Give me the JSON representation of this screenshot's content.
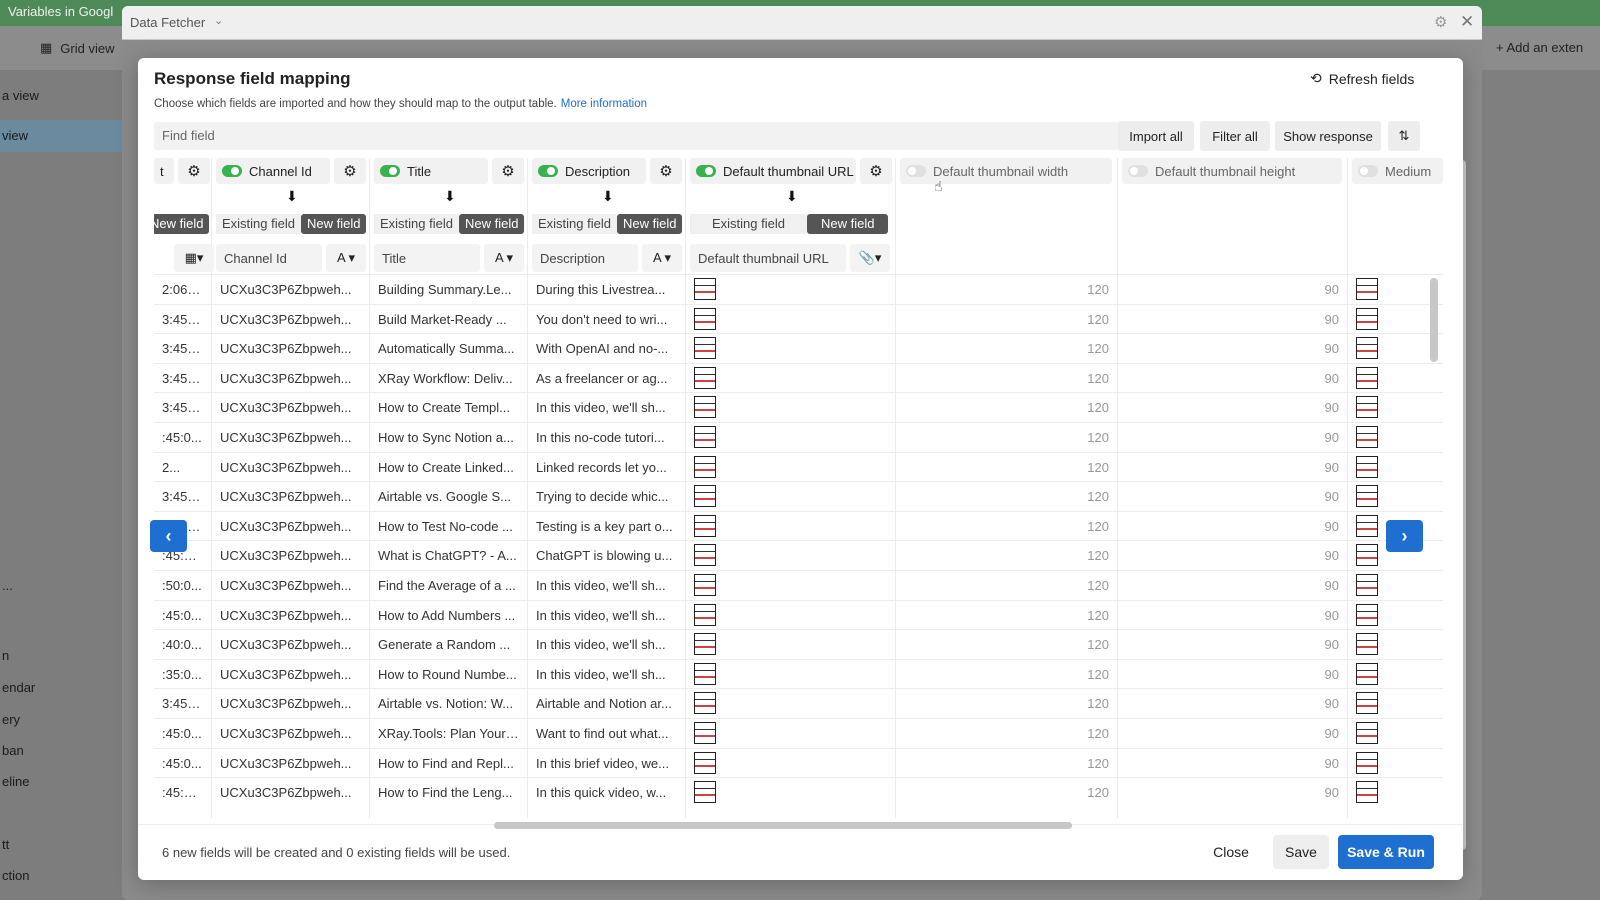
{
  "background": {
    "tab_title": "Variables in Googl",
    "grid_view": "Grid view",
    "add_extension": "Add an exten",
    "sidebar": [
      "a view",
      "view",
      "...",
      "n",
      "endar",
      "ery",
      "ban",
      "eline",
      "tt",
      "ction"
    ]
  },
  "frame": {
    "title": "Data Fetcher"
  },
  "modal": {
    "title": "Response field mapping",
    "refresh": "Refresh fields",
    "subtitle": "Choose which fields are imported and how they should map to the output table.",
    "more_info": "More information",
    "find_placeholder": "Find field",
    "buttons": {
      "import_all": "Import all",
      "filter_all": "Filter all",
      "show_response": "Show response"
    },
    "labels": {
      "existing": "Existing field",
      "new": "New field",
      "new_clipped": "New field"
    }
  },
  "columns": [
    {
      "key": "published",
      "name": "t",
      "field": ""
    },
    {
      "key": "channel",
      "name": "Channel Id",
      "field": "Channel Id",
      "type": "A"
    },
    {
      "key": "title",
      "name": "Title",
      "field": "Title",
      "type": "A"
    },
    {
      "key": "desc",
      "name": "Description",
      "field": "Description",
      "type": "A"
    },
    {
      "key": "thumb",
      "name": "Default thumbnail URL",
      "field": "Default thumbnail URL",
      "type": "📎"
    },
    {
      "key": "width",
      "name": "Default thumbnail width"
    },
    {
      "key": "height",
      "name": "Default thumbnail height"
    },
    {
      "key": "medium",
      "name": "Medium"
    }
  ],
  "rows": [
    {
      "published": "2:06:1...",
      "channel": "UCXu3C3P6Zbpweh...",
      "title": "Building Summary.Le...",
      "desc": "During this Livestrea...",
      "width": "120",
      "height": "90"
    },
    {
      "published": "3:45:0...",
      "channel": "UCXu3C3P6Zbpweh...",
      "title": "Build Market-Ready ...",
      "desc": "You don't need to wri...",
      "width": "120",
      "height": "90"
    },
    {
      "published": "3:45:0...",
      "channel": "UCXu3C3P6Zbpweh...",
      "title": "Automatically Summa...",
      "desc": "With OpenAI and no-...",
      "width": "120",
      "height": "90"
    },
    {
      "published": "3:45:0...",
      "channel": "UCXu3C3P6Zbpweh...",
      "title": "XRay Workflow: Deliv...",
      "desc": "As a freelancer or ag...",
      "width": "120",
      "height": "90"
    },
    {
      "published": "3:45:0...",
      "channel": "UCXu3C3P6Zbpweh...",
      "title": "How to Create Templ...",
      "desc": "In this video, we'll sh...",
      "width": "120",
      "height": "90"
    },
    {
      "published": ":45:0...",
      "channel": "UCXu3C3P6Zbpweh...",
      "title": "How to Sync Notion a...",
      "desc": "In this no-code tutori...",
      "width": "120",
      "height": "90"
    },
    {
      "published": "2...",
      "channel": "UCXu3C3P6Zbpweh...",
      "title": "How to Create Linked...",
      "desc": "Linked records let yo...",
      "width": "120",
      "height": "90"
    },
    {
      "published": "3:45:0...",
      "channel": "UCXu3C3P6Zbpweh...",
      "title": "Airtable vs. Google S...",
      "desc": "Trying to decide whic...",
      "width": "120",
      "height": "90"
    },
    {
      "published": "3:45:0...",
      "channel": "UCXu3C3P6Zbpweh...",
      "title": "How to Test No-code ...",
      "desc": "Testing is a key part o...",
      "width": "120",
      "height": "90"
    },
    {
      "published": ":45:02...",
      "channel": "UCXu3C3P6Zbpweh...",
      "title": "What is ChatGPT? - A...",
      "desc": "ChatGPT is blowing u...",
      "width": "120",
      "height": "90"
    },
    {
      "published": ":50:0...",
      "channel": "UCXu3C3P6Zbpweh...",
      "title": "Find the Average of a ...",
      "desc": "In this video, we'll sh...",
      "width": "120",
      "height": "90"
    },
    {
      "published": ":45:0...",
      "channel": "UCXu3C3P6Zbpweh...",
      "title": "How to Add Numbers ...",
      "desc": "In this video, we'll sh...",
      "width": "120",
      "height": "90"
    },
    {
      "published": ":40:0...",
      "channel": "UCXu3C3P6Zbpweh...",
      "title": "Generate a Random ...",
      "desc": "In this video, we'll sh...",
      "width": "120",
      "height": "90"
    },
    {
      "published": ":35:0...",
      "channel": "UCXu3C3P6Zbpweh...",
      "title": "How to Round Numbe...",
      "desc": "In this video, we'll sh...",
      "width": "120",
      "height": "90"
    },
    {
      "published": "3:45:0...",
      "channel": "UCXu3C3P6Zbpweh...",
      "title": "Airtable vs. Notion: W...",
      "desc": "Airtable and Notion ar...",
      "width": "120",
      "height": "90"
    },
    {
      "published": ":45:0...",
      "channel": "UCXu3C3P6Zbpweh...",
      "title": "XRay.Tools: Plan Your ...",
      "desc": "Want to find out what...",
      "width": "120",
      "height": "90"
    },
    {
      "published": ":45:0...",
      "channel": "UCXu3C3P6Zbpweh...",
      "title": "How to Find and Repl...",
      "desc": "In this brief video, we...",
      "width": "120",
      "height": "90"
    },
    {
      "published": ":45:01...",
      "channel": "UCXu3C3P6Zbpweh...",
      "title": "How to Find the Leng...",
      "desc": "In this quick video, w...",
      "width": "120",
      "height": "90"
    }
  ],
  "footer": {
    "message": "6 new fields will be created and 0 existing fields will be used.",
    "close": "Close",
    "save": "Save",
    "save_run": "Save & Run"
  },
  "colors": {
    "accent": "#1f6fd1",
    "toggle_on": "#37b24d"
  }
}
